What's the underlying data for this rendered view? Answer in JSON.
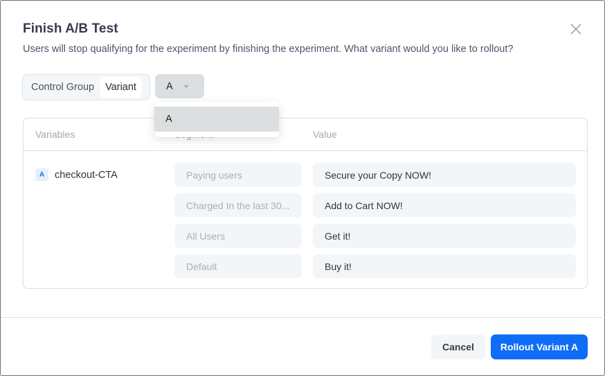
{
  "dialog": {
    "title": "Finish A/B Test",
    "subtitle": "Users will stop qualifying for the experiment by finishing the experiment. What variant would you like to rollout?",
    "close_icon": "close-icon"
  },
  "toggle": {
    "options": [
      {
        "label": "Control Group",
        "active": false
      },
      {
        "label": "Variant",
        "active": true
      }
    ]
  },
  "variant_select": {
    "selected": "A",
    "icon": "caret-down-icon",
    "options": [
      "A"
    ]
  },
  "table": {
    "headers": [
      "Variables",
      "Segment",
      "Value"
    ],
    "variable": {
      "badge": "A",
      "name": "checkout-CTA"
    },
    "rows": [
      {
        "segment": "Paying users",
        "value": "Secure your Copy NOW!"
      },
      {
        "segment": "Charged In the last 30...",
        "value": "Add to Cart NOW!"
      },
      {
        "segment": "All Users",
        "value": "Get it!"
      },
      {
        "segment": "Default",
        "value": "Buy it!"
      }
    ]
  },
  "footer": {
    "cancel_label": "Cancel",
    "primary_label": "Rollout Variant A"
  },
  "colors": {
    "primary": "#0f6cf5",
    "badge_text": "#1d6ef3",
    "badge_bg": "#e6f0fd"
  }
}
